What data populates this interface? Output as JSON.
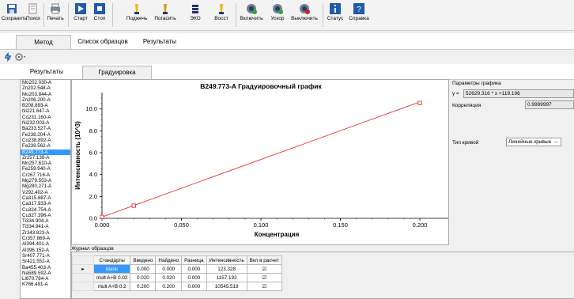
{
  "toolbar": {
    "save": "Сохранить",
    "search": "Поиск",
    "print": "Печать",
    "start": "Старт",
    "stop": "Стоп",
    "ignite": "Поджечь",
    "extinguish": "Погасить",
    "eco": "ЭКО",
    "restore": "Восст",
    "on": "Включить",
    "accel": "Ускор",
    "off": "Выключить",
    "status": "Статус",
    "help": "Справка"
  },
  "tabs_top": [
    "Метод",
    "Список образцов",
    "Результаты"
  ],
  "tabs_second": [
    "Результаты",
    "Градуировка"
  ],
  "line_list": [
    "Mo202.030-A",
    "Zn202.548-A",
    "Mo203.844-A",
    "Zn206.200-A",
    "B208.893-A",
    "Ni221.647-A",
    "Co231.160-A",
    "Ni232.003-A",
    "Ba233.527-A",
    "Fe238.204-A",
    "Co238.892-A",
    "Fe239.562-A",
    "B249.773-A",
    "Zr257.139-A",
    "Mn257.610-A",
    "Fe259.940-A",
    "Cr267.716-A",
    "Mg279.553-A",
    "Mg280.271-A",
    "V292.402-A",
    "Ca315.887-A",
    "Ca317.933-A",
    "Cu324.754-A",
    "Cu327.396-A",
    "Ti334.904-A",
    "Ti334.941-A",
    "Zr343.823-A",
    "Cr357.869-A",
    "Al394.401-A",
    "Al396.152-A",
    "Sr407.771-A",
    "Sr421.552-A",
    "Ba455.403-A",
    "Na589.592-A",
    "Li670.784-A",
    "K766.491-A"
  ],
  "selected_line": "B249.773-A",
  "params": {
    "title": "Параметры графика",
    "eq_label": "y =",
    "equation": "52629.316 * x +119.196",
    "corr_label": "Корреляция",
    "corr_value": "0.9999997",
    "curve_label": "Тип кривой",
    "curve_value": "Линейные кривые"
  },
  "journal": {
    "title": "Журнал образцов",
    "headers": [
      "Стандарты",
      "Введено",
      "Найдено",
      "Разница",
      "Интенсивность",
      "Вкл в расчет"
    ],
    "rows": [
      {
        "std": "blank",
        "entered": "0.000",
        "found": "0.000",
        "diff": "0.000",
        "intensity": "123.328",
        "included": "☑"
      },
      {
        "std": "mult A+B 0.02",
        "entered": "0.020",
        "found": "0.020",
        "diff": "0.000",
        "intensity": "1157.192",
        "included": "☑"
      },
      {
        "std": "mult A+B 0.2",
        "entered": "0.200",
        "found": "0.200",
        "diff": "0.000",
        "intensity": "10545.519",
        "included": "☑"
      }
    ]
  },
  "chart_data": {
    "type": "line",
    "title": "B249.773-A Градуировочный график",
    "xlabel": "Концентрация",
    "ylabel": "Интенсивность (10^3)",
    "xlim": [
      0,
      0.2
    ],
    "ylim": [
      0,
      11.5
    ],
    "x_ticks": [
      "0.000",
      "0.050",
      "0.100",
      "0.150",
      "0.200"
    ],
    "y_ticks": [
      "0.0",
      "2.0",
      "4.0",
      "6.0",
      "8.0",
      "10.0"
    ],
    "points": [
      [
        0.0,
        0.123
      ],
      [
        0.02,
        1.157
      ],
      [
        0.2,
        10.546
      ]
    ],
    "fit_line": [
      [
        0.0,
        0.119
      ],
      [
        0.2,
        10.645
      ]
    ],
    "grid": false
  },
  "colors": {
    "line": "#e8191c",
    "selection": "#3399ff"
  }
}
